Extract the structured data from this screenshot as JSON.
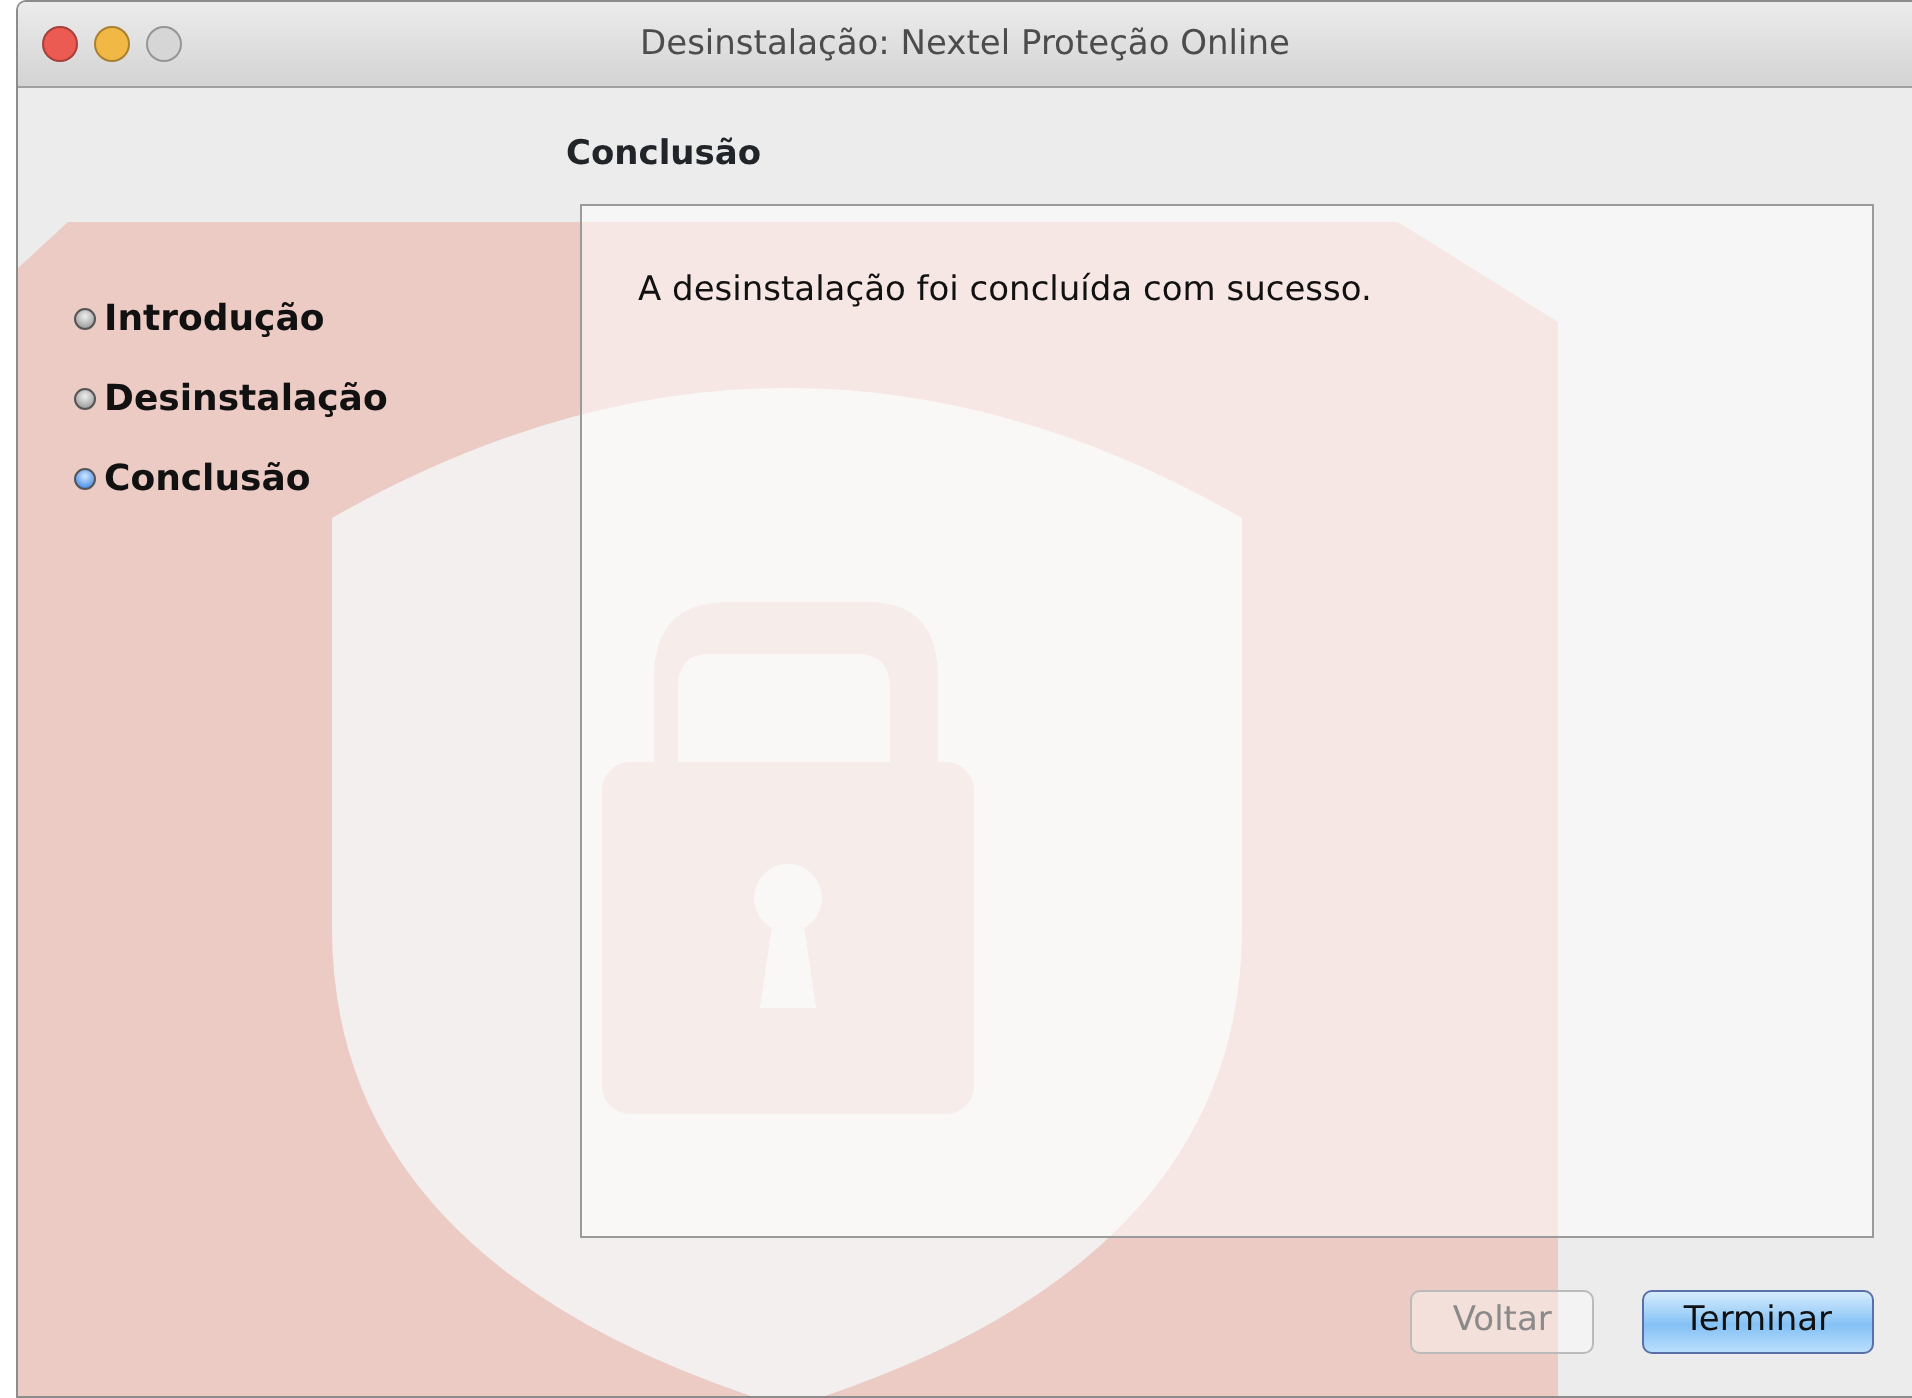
{
  "window": {
    "title": "Desinstalação: Nextel Proteção Online"
  },
  "heading": "Conclusão",
  "steps": [
    {
      "label": "Introdução",
      "selected": false
    },
    {
      "label": "Desinstalação",
      "selected": false
    },
    {
      "label": "Conclusão",
      "selected": true
    }
  ],
  "message": "A desinstalação foi concluída com sucesso.",
  "buttons": [
    {
      "label": "Voltar",
      "kind": "secondary",
      "disabled": true
    },
    {
      "label": "Terminar",
      "kind": "default",
      "disabled": false
    }
  ]
}
